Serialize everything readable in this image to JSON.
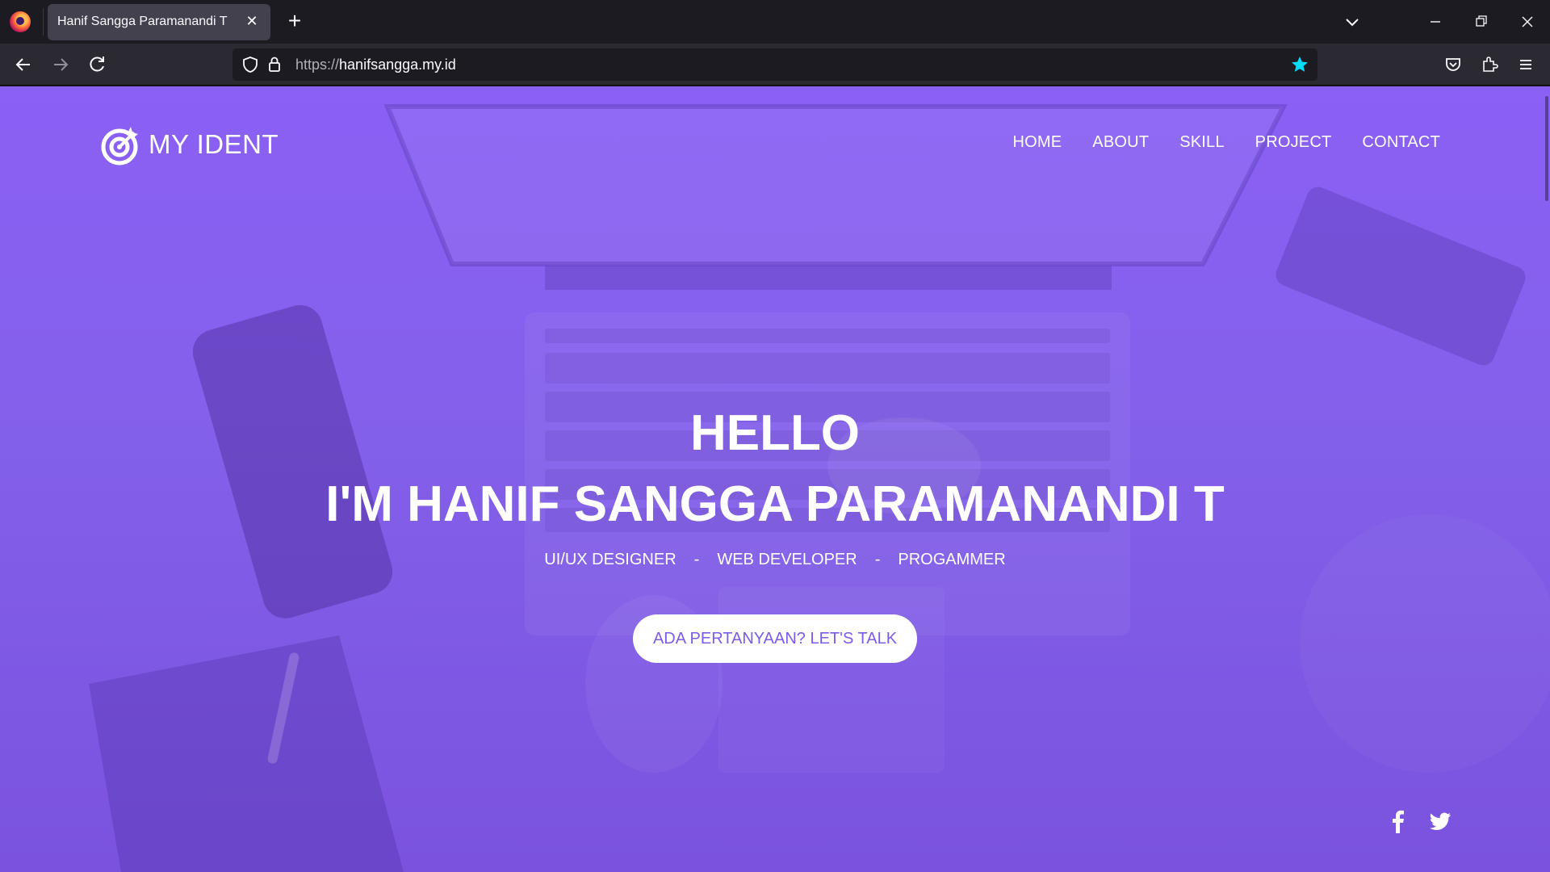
{
  "browser": {
    "tab_title": "Hanif Sangga Paramanandi T",
    "url_scheme": "https://",
    "url_host": "hanifsangga.my.id",
    "accent": "#00ddff"
  },
  "site": {
    "brand": "MY IDENT",
    "nav": [
      "HOME",
      "ABOUT",
      "SKILL",
      "PROJECT",
      "CONTACT"
    ],
    "hero": {
      "greeting": "HELLO",
      "name": "I'M HANIF SANGGA PARAMANANDI T",
      "roles": [
        "UI/UX DESIGNER",
        "-",
        "WEB DEVELOPER",
        "-",
        "PROGAMMER"
      ],
      "cta": "ADA PERTANYAAN? LET'S TALK"
    },
    "social_icons": [
      "facebook-icon",
      "twitter-icon"
    ],
    "overlay_color": "#8b60f5"
  }
}
